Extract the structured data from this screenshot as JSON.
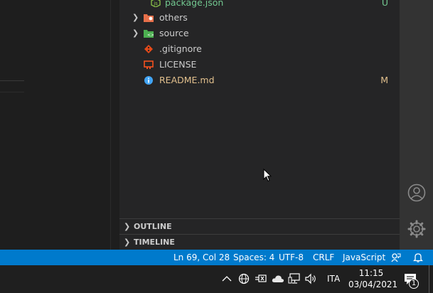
{
  "explorer": {
    "items": [
      {
        "label": "package.json",
        "badge": "U",
        "kind": "untracked",
        "icon": "json-icon",
        "chevron": false,
        "indent": true
      },
      {
        "label": "others",
        "badge": "",
        "kind": "folder",
        "icon": "folder-icon",
        "chevron": true
      },
      {
        "label": "source",
        "badge": "",
        "kind": "folder",
        "icon": "folder-icon",
        "chevron": true
      },
      {
        "label": ".gitignore",
        "badge": "",
        "kind": "file",
        "icon": "git-icon",
        "chevron": false
      },
      {
        "label": "LICENSE",
        "badge": "",
        "kind": "file",
        "icon": "license-icon",
        "chevron": false
      },
      {
        "label": "README.md",
        "badge": "M",
        "kind": "modified",
        "icon": "info-icon",
        "chevron": false
      }
    ]
  },
  "sections": {
    "outline": "OUTLINE",
    "timeline": "TIMELINE"
  },
  "activity_bar": {
    "accounts_icon": "account-icon",
    "settings_icon": "gear-icon"
  },
  "status_bar": {
    "position": "Ln 69, Col 28",
    "spaces": "Spaces: 4",
    "encoding": "UTF-8",
    "eol": "CRLF",
    "language": "JavaScript",
    "feedback_icon": "feedback-icon",
    "bell_icon": "bell-icon",
    "color": "#007acc"
  },
  "taskbar": {
    "language": "ITA",
    "time": "11:15",
    "date": "03/04/2021",
    "notification_count": "1"
  },
  "colors": {
    "modified": "#e2c08d",
    "untracked": "#73c991",
    "sidebar_bg": "#252526",
    "editor_bg": "#1e1e1e"
  }
}
